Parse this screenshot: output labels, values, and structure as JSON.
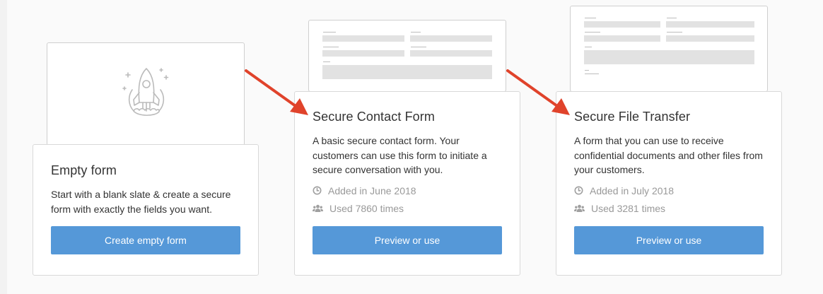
{
  "templates": [
    {
      "title": "Empty form",
      "description": "Start with a blank slate & create a secure form with exactly the fields you want.",
      "button_label": "Create empty form",
      "icon": "rocket-icon"
    },
    {
      "title": "Secure Contact Form",
      "description": "A basic secure contact form. Your customers can use this form to initiate a secure conversation with you.",
      "added": "Added in June 2018",
      "used": "Used 7860 times",
      "button_label": "Preview or use"
    },
    {
      "title": "Secure File Transfer",
      "description": "A form that you can use to receive confidential documents and other files from your customers.",
      "added": "Added in July 2018",
      "used": "Used 3281 times",
      "button_label": "Preview or use"
    }
  ],
  "colors": {
    "button": "#5598d8",
    "arrow": "#e0432b",
    "meta_text": "#999999"
  },
  "icons": {
    "added": "clock-icon",
    "used": "users-icon"
  }
}
